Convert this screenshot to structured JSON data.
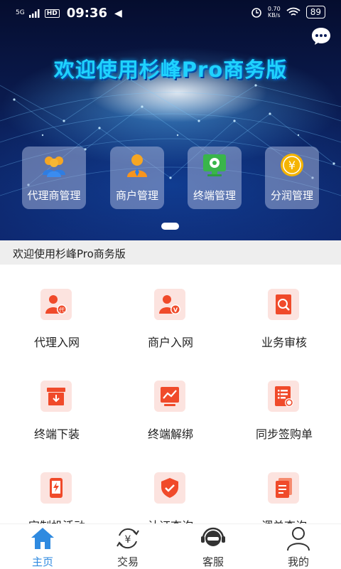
{
  "status_bar": {
    "network": "5G",
    "hd": "HD",
    "time": "09:36",
    "speed_value": "0.70",
    "speed_unit": "KB/s",
    "battery": "89"
  },
  "hero": {
    "title": "欢迎使用杉峰Pro商务版",
    "quick_actions": [
      {
        "label": "代理商管理",
        "icon": "agent-group-icon"
      },
      {
        "label": "商户管理",
        "icon": "merchant-person-icon"
      },
      {
        "label": "终端管理",
        "icon": "terminal-monitor-icon"
      },
      {
        "label": "分润管理",
        "icon": "yen-coin-icon"
      }
    ]
  },
  "notice": "欢迎使用杉峰Pro商务版",
  "grid": [
    {
      "label": "代理入网",
      "icon": "agent-register-icon"
    },
    {
      "label": "商户入网",
      "icon": "merchant-register-icon"
    },
    {
      "label": "业务审核",
      "icon": "document-search-icon"
    },
    {
      "label": "终端下装",
      "icon": "download-box-icon"
    },
    {
      "label": "终端解绑",
      "icon": "chart-monitor-icon"
    },
    {
      "label": "同步签购单",
      "icon": "list-sync-icon"
    },
    {
      "label": "定制机活动",
      "icon": "phone-lightning-icon"
    },
    {
      "label": "认证查询",
      "icon": "shield-check-icon"
    },
    {
      "label": "调单查询",
      "icon": "document-stack-icon"
    }
  ],
  "bottom_nav": [
    {
      "label": "主页",
      "icon": "home-icon",
      "active": true
    },
    {
      "label": "交易",
      "icon": "yen-exchange-icon",
      "active": false
    },
    {
      "label": "客服",
      "icon": "headset-icon",
      "active": false
    },
    {
      "label": "我的",
      "icon": "user-icon",
      "active": false
    }
  ],
  "colors": {
    "accent": "#2f8ae0",
    "icon_red": "#f04a2a",
    "icon_bg": "#fce3df",
    "hero_title": "#1fd2ff"
  }
}
